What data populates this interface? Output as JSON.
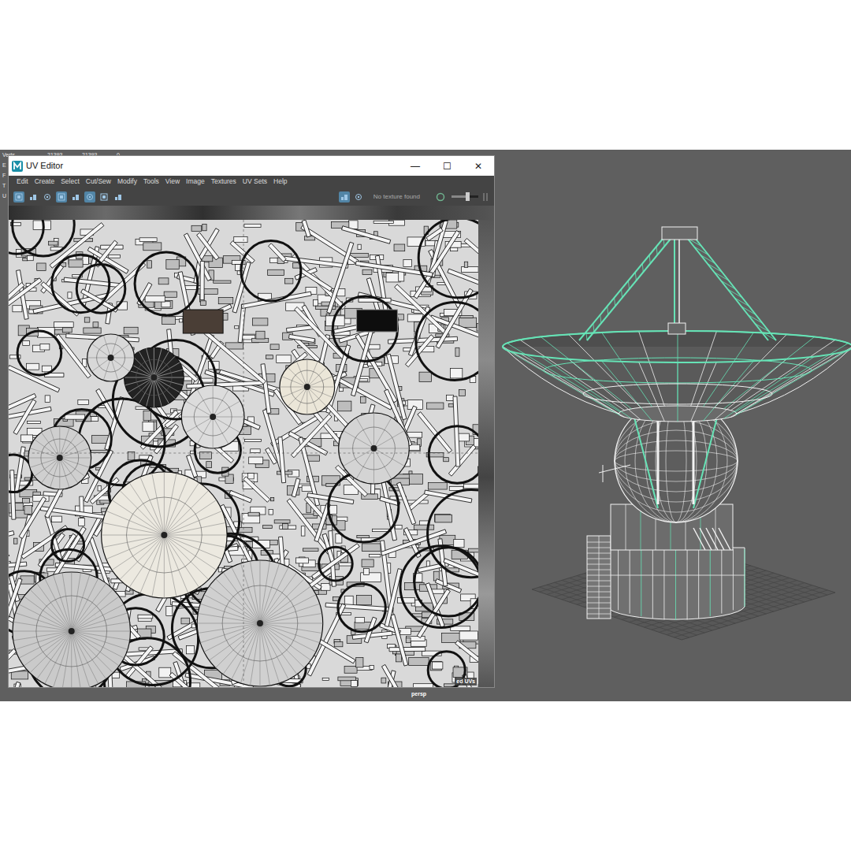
{
  "stats": {
    "rows": [
      {
        "label": "Verts",
        "values": [
          "21393",
          "21393",
          "0"
        ]
      },
      {
        "label": "E",
        "values": []
      },
      {
        "label": "F",
        "values": []
      },
      {
        "label": "T",
        "values": []
      },
      {
        "label": "U",
        "values": []
      }
    ]
  },
  "uv_editor": {
    "title": "UV Editor",
    "window_buttons": [
      "—",
      "☐",
      "✕"
    ],
    "menu": [
      "Edit",
      "Create",
      "Select",
      "Cut/Sew",
      "Modify",
      "Tools",
      "View",
      "Image",
      "Textures",
      "UV Sets",
      "Help"
    ],
    "toolbar": {
      "left_tools": [
        {
          "selected": true
        },
        {
          "selected": false
        },
        {
          "selected": false
        },
        {
          "selected": true
        },
        {
          "selected": false
        },
        {
          "selected": true
        },
        {
          "selected": false
        },
        {
          "selected": false
        }
      ],
      "right_tools": [
        {
          "selected": true
        },
        {
          "selected": false
        }
      ],
      "texture_status": "No texture found",
      "exposure_level": 0.6
    },
    "footer_text": "ed UVs"
  },
  "viewport": {
    "camera": "persp"
  }
}
